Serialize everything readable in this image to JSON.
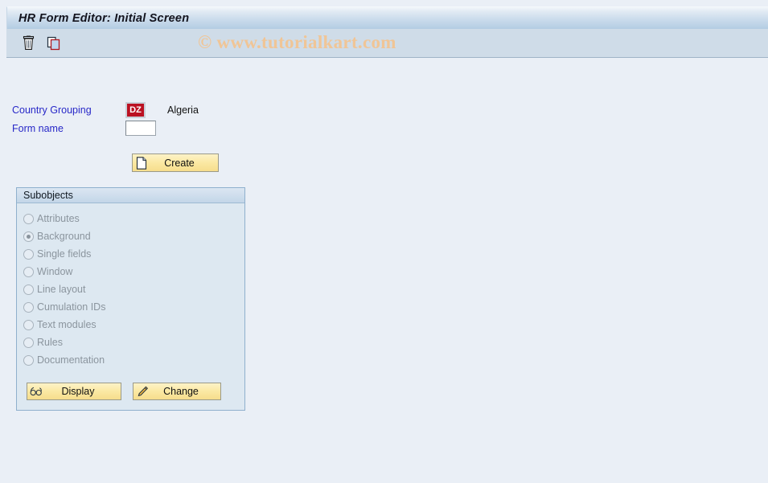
{
  "window": {
    "title": "HR Form Editor: Initial Screen"
  },
  "watermark": {
    "text": "© www.tutorialkart.com"
  },
  "toolbar": {
    "buttons": [
      {
        "name": "delete-icon",
        "tooltip": "Delete"
      },
      {
        "name": "copy-icon",
        "tooltip": "Copy"
      }
    ]
  },
  "form": {
    "country_grouping": {
      "label": "Country Grouping",
      "value": "DZ",
      "placeholder": "",
      "description": "Algeria"
    },
    "form_name": {
      "label": "Form name",
      "value": "",
      "placeholder": ""
    },
    "create_button": {
      "label": "Create",
      "icon": "new-document-icon"
    }
  },
  "subobjects": {
    "title": "Subobjects",
    "selected": "Background",
    "options": [
      {
        "label": "Attributes",
        "selected": false
      },
      {
        "label": "Background",
        "selected": true
      },
      {
        "label": "Single fields",
        "selected": false
      },
      {
        "label": "Window",
        "selected": false
      },
      {
        "label": "Line layout",
        "selected": false
      },
      {
        "label": "Cumulation IDs",
        "selected": false
      },
      {
        "label": "Text modules",
        "selected": false
      },
      {
        "label": "Rules",
        "selected": false
      },
      {
        "label": "Documentation",
        "selected": false
      }
    ],
    "actions": [
      {
        "label": "Display",
        "icon": "glasses-icon"
      },
      {
        "label": "Change",
        "icon": "pencil-icon"
      }
    ]
  },
  "colors": {
    "titlebar_top": "#f2f6fa",
    "titlebar_bottom": "#b4cde3",
    "toolbar_bg": "#cfdce8",
    "content_bg": "#eaeff6",
    "label_blue": "#2828c8",
    "country_field_red": "#bb1122",
    "button_yellow": "#fbe9a4",
    "groupbox_bg": "#dde8f1",
    "groupbox_border": "#8fb0cd",
    "disabled_text": "#8b959e",
    "watermark_orange": "#f0c596"
  }
}
